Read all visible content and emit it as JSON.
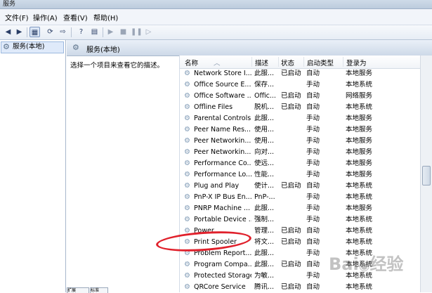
{
  "window": {
    "title": "服务"
  },
  "menu": [
    "文件(F)",
    "操作(A)",
    "查看(V)",
    "帮助(H)"
  ],
  "toolbar": {
    "icons": [
      "back-arrow-icon",
      "forward-arrow-icon",
      "up-folder-icon",
      "console-tree-icon",
      "refresh-icon",
      "export-list-icon",
      "help-icon",
      "properties-icon",
      "start-service-icon",
      "stop-service-icon",
      "pause-service-icon",
      "restart-service-icon"
    ]
  },
  "tree": {
    "root_label": "服务(本地)"
  },
  "pane": {
    "header": "服务(本地)",
    "description_prompt": "选择一个项目来查看它的描述。"
  },
  "columns": {
    "name": "名称",
    "description": "描述",
    "status": "状态",
    "startup": "启动类型",
    "logon": "登录为"
  },
  "services": [
    {
      "name": "Network Store I...",
      "desc": "此服...",
      "status": "已启动",
      "startup": "自动",
      "logon": "本地服务"
    },
    {
      "name": "Office  Source E...",
      "desc": "保存...",
      "status": "",
      "startup": "手动",
      "logon": "本地系统"
    },
    {
      "name": "Office Software ...",
      "desc": "Offic...",
      "status": "已启动",
      "startup": "自动",
      "logon": "网络服务"
    },
    {
      "name": "Offline Files",
      "desc": "脱机...",
      "status": "已启动",
      "startup": "自动",
      "logon": "本地系统"
    },
    {
      "name": "Parental Controls",
      "desc": "此服...",
      "status": "",
      "startup": "手动",
      "logon": "本地服务"
    },
    {
      "name": "Peer Name Res...",
      "desc": "使用...",
      "status": "",
      "startup": "手动",
      "logon": "本地服务"
    },
    {
      "name": "Peer Networkin...",
      "desc": "使用...",
      "status": "",
      "startup": "手动",
      "logon": "本地服务"
    },
    {
      "name": "Peer Networkin...",
      "desc": "向对...",
      "status": "",
      "startup": "手动",
      "logon": "本地服务"
    },
    {
      "name": "Performance Co...",
      "desc": "使远...",
      "status": "",
      "startup": "手动",
      "logon": "本地服务"
    },
    {
      "name": "Performance Lo...",
      "desc": "性能...",
      "status": "",
      "startup": "手动",
      "logon": "本地服务"
    },
    {
      "name": "Plug and Play",
      "desc": "使计...",
      "status": "已启动",
      "startup": "自动",
      "logon": "本地系统"
    },
    {
      "name": "PnP-X IP Bus En...",
      "desc": "PnP-...",
      "status": "",
      "startup": "手动",
      "logon": "本地系统"
    },
    {
      "name": "PNRP Machine ...",
      "desc": "此服...",
      "status": "",
      "startup": "手动",
      "logon": "本地服务"
    },
    {
      "name": "Portable Device ...",
      "desc": "强制...",
      "status": "",
      "startup": "手动",
      "logon": "本地系统"
    },
    {
      "name": "Power",
      "desc": "管理...",
      "status": "已启动",
      "startup": "自动",
      "logon": "本地系统"
    },
    {
      "name": "Print Spooler",
      "desc": "将文...",
      "status": "已启动",
      "startup": "自动",
      "logon": "本地系统"
    },
    {
      "name": "Problem Report...",
      "desc": "此服...",
      "status": "",
      "startup": "手动",
      "logon": "本地系统"
    },
    {
      "name": "Program Compa...",
      "desc": "此服...",
      "status": "已启动",
      "startup": "自动",
      "logon": "本地系统"
    },
    {
      "name": "Protected Storage",
      "desc": "为敏...",
      "status": "",
      "startup": "手动",
      "logon": "本地系统"
    },
    {
      "name": "QRCore Service",
      "desc": "腾讯...",
      "status": "已启动",
      "startup": "自动",
      "logon": "本地系统"
    }
  ],
  "bottom_tabs": [
    "扩展",
    "标准"
  ],
  "watermark": "Baidu经验",
  "colors": {
    "highlight_circle": "#e0202b",
    "tree_selection": "#dfeafa",
    "header_gradient_end": "#cdd9e8"
  }
}
